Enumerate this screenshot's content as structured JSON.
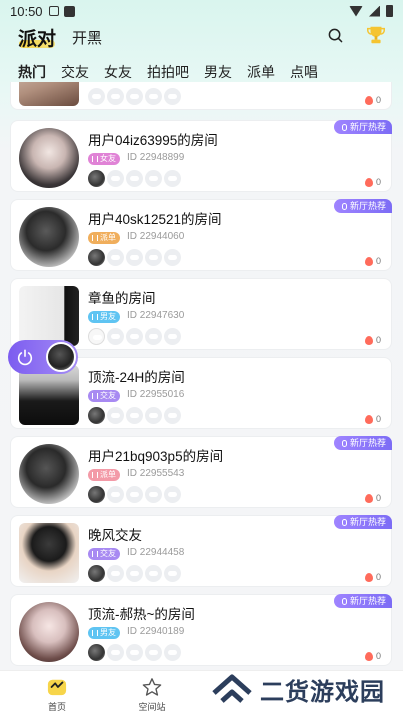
{
  "status_bar": {
    "time": "10:50",
    "icon_a": "A"
  },
  "header": {
    "title": "派对",
    "subtitle": "开黑"
  },
  "tabs": [
    "热门",
    "交友",
    "女友",
    "拍拍吧",
    "男友",
    "派单",
    "点唱"
  ],
  "float_pill": {
    "icon": "power-icon"
  },
  "rooms": [
    {
      "name": "",
      "tag": "",
      "id": "",
      "hot": "0",
      "badge": ""
    },
    {
      "name": "用户04iz63995的房间",
      "tag": "女友",
      "tag_color": "#e083d6",
      "id": "ID 22948899",
      "hot": "0",
      "badge": "新厅热荐"
    },
    {
      "name": "用户40sk12521的房间",
      "tag": "派单",
      "tag_color": "#f0ae5c",
      "id": "ID 22944060",
      "hot": "0",
      "badge": "新厅热荐"
    },
    {
      "name": "章鱼的房间",
      "tag": "男友",
      "tag_color": "#5fc4f2",
      "id": "ID 22947630",
      "hot": "0",
      "badge": ""
    },
    {
      "name": "顶流-24H的房间",
      "tag": "交友",
      "tag_color": "#a88af2",
      "id": "ID 22955016",
      "hot": "0",
      "badge": ""
    },
    {
      "name": "用户21bq903p5的房间",
      "tag": "派单",
      "tag_color": "#f39aa7",
      "id": "ID 22955543",
      "hot": "0",
      "badge": "新厅热荐"
    },
    {
      "name": "晚风交友",
      "tag": "交友",
      "tag_color": "#a88af2",
      "id": "ID 22944458",
      "hot": "0",
      "badge": "新厅热荐"
    },
    {
      "name": "顶流-郝热~的房间",
      "tag": "男友",
      "tag_color": "#5fc4f2",
      "id": "ID 22940189",
      "hot": "0",
      "badge": "新厅热荐"
    }
  ],
  "bottom_nav": {
    "home": "首页",
    "space": "空间站"
  },
  "watermark": {
    "text": "二货游戏园"
  }
}
